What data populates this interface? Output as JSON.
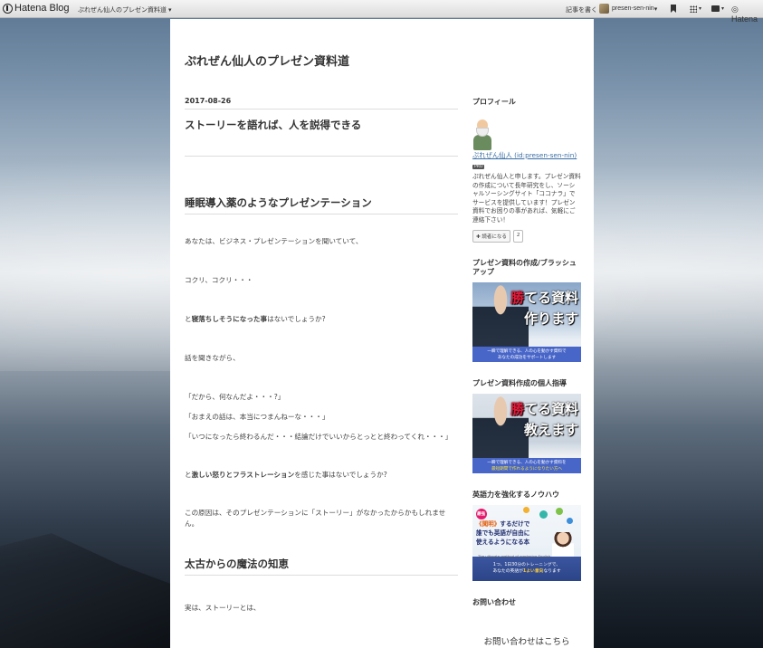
{
  "topbar": {
    "brand": "Hatena Blog",
    "blog_menu": "ぷれぜん仙人のプレゼン資料道",
    "write_link": "記事を書く",
    "user_name": "presen-sen-nin",
    "brand_right": "Hatena",
    "icons": [
      "hatena-logo-icon",
      "bookmark-icon",
      "grid-icon",
      "comment-icon",
      "hatena-mark-icon"
    ]
  },
  "blog": {
    "title": "ぷれぜん仙人のプレゼン資料道"
  },
  "entry": {
    "date": "2017-08-26",
    "title": "ストーリーを語れば、人を説得できる",
    "section1_heading": "睡眠導入薬のようなプレゼンテーション",
    "p1": "あなたは、ビジネス・プレゼンテーションを聞いていて、",
    "p2": "コクリ、コクリ・・・",
    "p3_pre": "と",
    "p3_bold": "寝落ちしそうになった事",
    "p3_post": "はないでしょうか?",
    "p4": "話を聞きながら、",
    "q1": "「だから、何なんだよ・・・?」",
    "q2": "「おまえの話は、本当につまんねーな・・・」",
    "q3": "「いつになったら終わるんだ・・・結論だけでいいからとっとと終わってくれ・・・」",
    "p5_pre": "と",
    "p5_bold": "激しい怒りとフラストレーション",
    "p5_post": "を感じた事はないでしょうか?",
    "p6": "この原因は、そのプレゼンテーションに「ストーリー」がなかったからかもしれません。",
    "section2_heading": "太古からの魔法の知恵",
    "p7": "実は、ストーリーとは、"
  },
  "sidebar": {
    "profile_title": "プロフィール",
    "profile_name": "ぷれぜん仙人 (id:presen-sen-nin)",
    "pro_badge": "PRO",
    "profile_desc": "ぷれぜん仙人と申します。プレゼン資料の作成について長年研究をし、ソーシャルソーシングサイト「ココナラ」でサービスを提供しています！プレゼン資料でお困りの事があれば、気軽にご連絡下さい！",
    "reader_button": "読者になる",
    "reader_count": "2",
    "module2_title": "プレゼン資料の作成/ブラッシュアップ",
    "banner1": {
      "red": "勝",
      "line1": "てる資料",
      "line2": "作ります",
      "strip1": "一瞬で理解できる、人の心を動かす資料で",
      "strip2": "あなたの成功をサポートします"
    },
    "module3_title": "プレゼン資料作成の個人指導",
    "banner2": {
      "red": "勝",
      "line1": "てる資料",
      "line2": "教えます",
      "strip1": "一瞬で理解できる、人の心を動かす資料を",
      "strip2": "最短期間で作れるようになりたい方へ"
    },
    "module4_title": "英語力を強化するノウハウ",
    "banner3": {
      "badge": "最強",
      "line1a": "《聞明》",
      "line1b": "するだけで",
      "line2": "誰でも英語が自由に",
      "line3": "使えるようになる本",
      "sub": "The ultimate method of mastering English",
      "bottom1": "1つ、1日30分のトレーニングで、",
      "bottom2a": "あなたの英語が",
      "bottom2b": "1よい意向",
      "bottom2c": "なります"
    },
    "contact_title": "お問い合わせ",
    "contact_link": "お問い合わせはこちら"
  }
}
